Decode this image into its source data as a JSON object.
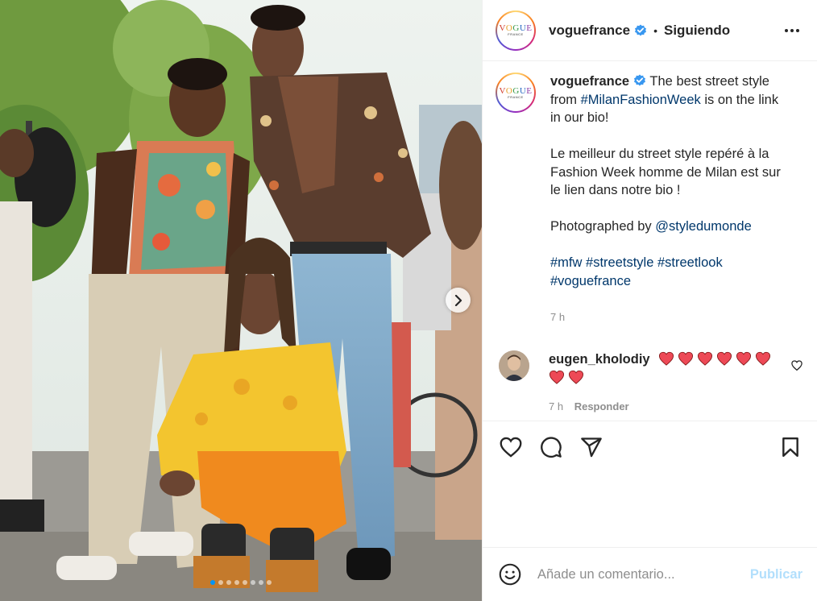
{
  "post": {
    "username": "voguefrance",
    "follow_separator": "•",
    "follow_status": "Siguiendo",
    "avatar_brand": "VOGUE",
    "avatar_sub": "FRANCE"
  },
  "caption": {
    "username": "voguefrance",
    "line1_pre": "The best street style from ",
    "line1_tag": "#MilanFashionWeek",
    "line1_post": " is on the link in our bio!",
    "para2": "Le meilleur du street style repéré à la Fashion Week homme de Milan est sur le lien dans notre bio !",
    "para3_pre": "Photographed by ",
    "para3_mention": "@styledumonde",
    "tags": [
      "#mfw",
      "#streetstyle",
      "#streetlook",
      "#voguefrance"
    ],
    "time": "7 h"
  },
  "comment": {
    "username": "eugen_kholodiy",
    "hearts": 8,
    "time": "7 h",
    "reply_label": "Responder"
  },
  "carousel": {
    "slides": 8,
    "active_index": 0
  },
  "add_comment": {
    "placeholder": "Añade un comentario...",
    "publish_label": "Publicar"
  },
  "icons": {
    "verified": "verified-badge-icon",
    "more": "more-options-icon",
    "like": "heart-icon",
    "comment": "comment-icon",
    "share": "paper-plane-icon",
    "save": "bookmark-icon",
    "emoji": "emoji-icon",
    "next": "chevron-right-icon"
  },
  "colors": {
    "accent": "#0095f6",
    "heart_red": "#ed4956",
    "link": "#00376b",
    "muted": "#8e8e8e",
    "publish_disabled": "#b2dffc"
  }
}
